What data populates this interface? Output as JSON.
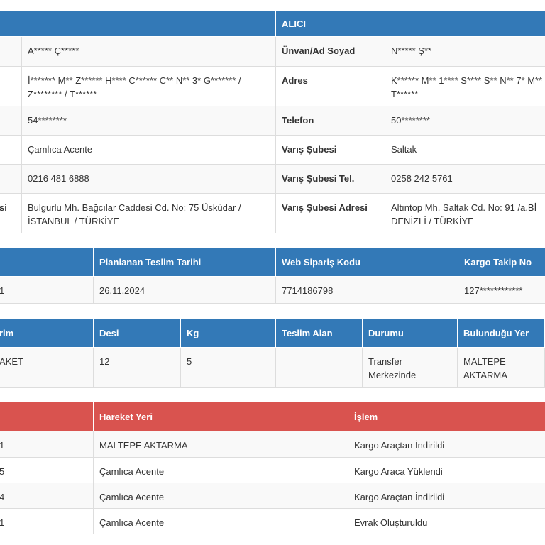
{
  "info_table": {
    "receiver_header": "ALICI",
    "rows": [
      {
        "sender_label_tail": "",
        "sender_value": "A***** Ç*****",
        "receiver_label": "Ünvan/Ad Soyad",
        "receiver_value": "N***** Ş**"
      },
      {
        "sender_label_tail": "",
        "sender_value": "İ******* M** Z****** H**** C****** C** N** 3* G******* / Z******** / T******",
        "receiver_label": "Adres",
        "receiver_value": "K****** M** 1**** S**** S** N** 7* M** T******"
      },
      {
        "sender_label_tail": "",
        "sender_value": "54********",
        "receiver_label": "Telefon",
        "receiver_value": "50********"
      },
      {
        "sender_label_tail": "",
        "sender_value": "Çamlıca Acente",
        "receiver_label": "Varış Şubesi",
        "receiver_value": "Saltak"
      },
      {
        "sender_label_tail": "",
        "sender_value": "0216 481 6888",
        "receiver_label": "Varış Şubesi Tel.",
        "receiver_value": "0258 242 5761"
      },
      {
        "sender_label_tail": "si",
        "sender_value": "Bulgurlu Mh. Bağcılar Caddesi Cd. No: 75 Üsküdar / İSTANBUL / TÜRKİYE",
        "receiver_label": "Varış Şubesi Adresi",
        "receiver_value": "Altıntop Mh. Saltak Cd. No: 91 /a.Bİ DENİZLİ / TÜRKİYE"
      }
    ]
  },
  "shipment_table": {
    "headers": [
      "",
      "Planlanan Teslim Tarihi",
      "Web Sipariş Kodu",
      "Kargo Takip No"
    ],
    "row": [
      "1",
      "26.11.2024",
      "7714186798",
      "127************"
    ]
  },
  "package_table": {
    "headers": [
      "rim",
      "Desi",
      "Kg",
      "Teslim Alan",
      "Durumu",
      "Bulunduğu Yer"
    ],
    "row": [
      "AKET",
      "12",
      "5",
      "",
      "Transfer Merkezinde",
      "MALTEPE AKTARMA"
    ]
  },
  "movement_table": {
    "headers": [
      "",
      "Hareket Yeri",
      "İşlem"
    ],
    "rows": [
      [
        "1",
        "MALTEPE AKTARMA",
        "Kargo Araçtan İndirildi"
      ],
      [
        "5",
        "Çamlıca Acente",
        "Kargo Araca Yüklendi"
      ],
      [
        "4",
        "Çamlıca Acente",
        "Kargo Araçtan İndirildi"
      ],
      [
        "1",
        "Çamlıca Acente",
        "Evrak Oluşturuldu"
      ]
    ]
  },
  "colors": {
    "header_blue": "#3379b7",
    "header_red": "#d9534f",
    "row_alt": "#f9f9f9",
    "border": "#dddddd"
  }
}
